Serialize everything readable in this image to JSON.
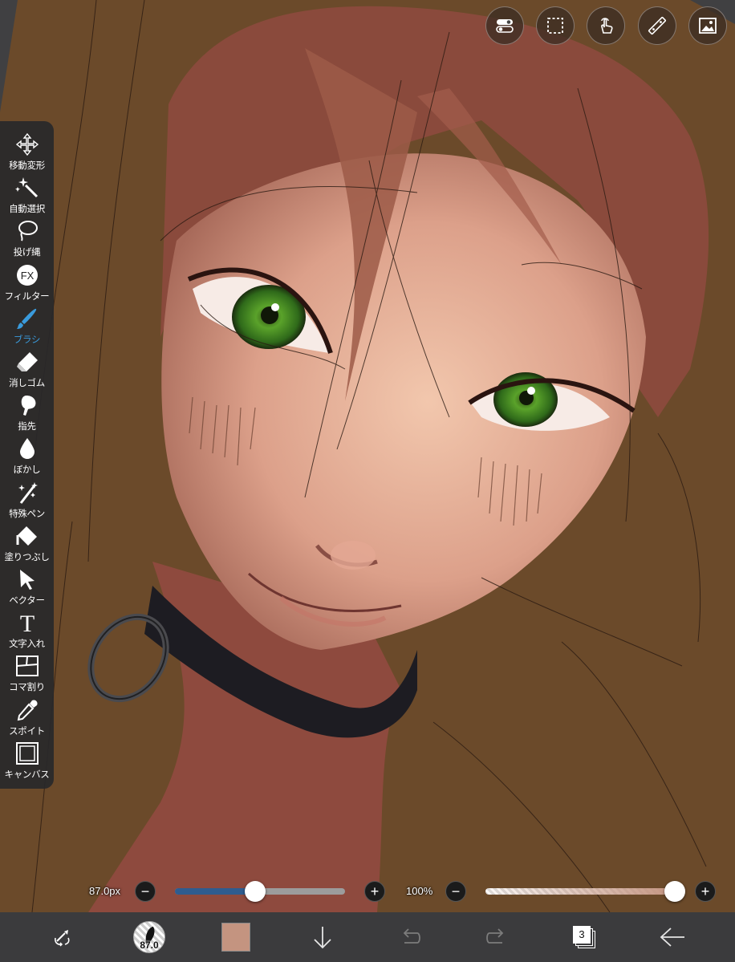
{
  "top_buttons": [
    {
      "name": "toggle-icon"
    },
    {
      "name": "selection-icon"
    },
    {
      "name": "touch-icon"
    },
    {
      "name": "ruler-icon"
    },
    {
      "name": "image-icon"
    }
  ],
  "toolbar": {
    "tools": [
      {
        "id": "move",
        "label": "移動変形",
        "icon": "move-icon",
        "active": false
      },
      {
        "id": "magic-wand",
        "label": "自動選択",
        "icon": "magic-wand-icon",
        "active": false
      },
      {
        "id": "lasso",
        "label": "投げ縄",
        "icon": "lasso-icon",
        "active": false
      },
      {
        "id": "filter",
        "label": "フィルター",
        "icon": "fx-icon",
        "active": false
      },
      {
        "id": "brush",
        "label": "ブラシ",
        "icon": "brush-icon",
        "active": true
      },
      {
        "id": "eraser",
        "label": "消しゴム",
        "icon": "eraser-icon",
        "active": false
      },
      {
        "id": "finger",
        "label": "指先",
        "icon": "finger-icon",
        "active": false
      },
      {
        "id": "blur",
        "label": "ぼかし",
        "icon": "blur-drop-icon",
        "active": false
      },
      {
        "id": "special-pen",
        "label": "特殊ペン",
        "icon": "special-pen-icon",
        "active": false
      },
      {
        "id": "fill",
        "label": "塗りつぶし",
        "icon": "fill-bucket-icon",
        "active": false
      },
      {
        "id": "vector",
        "label": "ベクター",
        "icon": "vector-arrow-icon",
        "active": false
      },
      {
        "id": "text",
        "label": "文字入れ",
        "icon": "text-icon",
        "active": false
      },
      {
        "id": "frame",
        "label": "コマ割り",
        "icon": "frame-divide-icon",
        "active": false
      },
      {
        "id": "eyedropper",
        "label": "スポイト",
        "icon": "eyedropper-icon",
        "active": false
      },
      {
        "id": "canvas",
        "label": "キャンバス",
        "icon": "canvas-icon",
        "active": false
      }
    ],
    "accent": "#3a9bdc"
  },
  "brush_size": {
    "label": "87.0px",
    "value_fraction": 0.47,
    "minus": "−",
    "plus": "+"
  },
  "opacity": {
    "label": "100%",
    "value_fraction": 1.0,
    "minus": "−",
    "plus": "+"
  },
  "bottom_bar": {
    "brush_size_badge": "87.0",
    "current_color": "#c49480",
    "layer_count": "3",
    "icons": [
      "swap-brush-icon",
      "brush-size-icon",
      "color-swatch",
      "download-icon",
      "undo-icon",
      "redo-icon",
      "layers-icon",
      "back-arrow-icon"
    ]
  }
}
